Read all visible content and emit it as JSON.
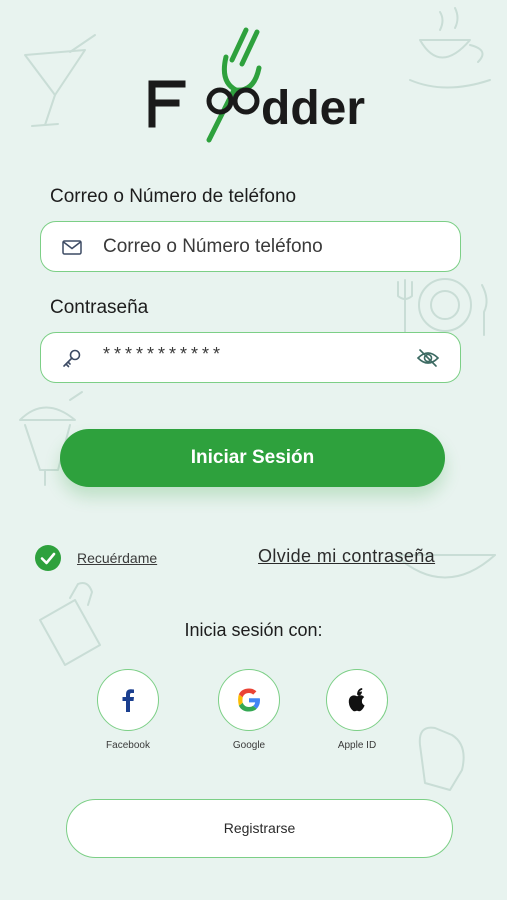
{
  "app": {
    "brand": "Foodder"
  },
  "form": {
    "email_label": "Correo o Número de teléfono",
    "email_placeholder": "Correo o Número teléfono",
    "password_label": "Contraseña",
    "password_value": "***********",
    "email_icon": "mail-icon",
    "password_icon": "key-icon",
    "toggle_icon": "eye-off-icon"
  },
  "actions": {
    "login_label": "Iniciar Sesión",
    "remember_label": "Recuérdame",
    "forgot_label": "Olvide mi contraseña",
    "register_label": "Registrarse"
  },
  "social": {
    "title": "Inicia sesión con:",
    "providers": [
      {
        "label": "Facebook",
        "icon": "facebook-icon"
      },
      {
        "label": "Google",
        "icon": "google-icon"
      },
      {
        "label": "Apple ID",
        "icon": "apple-icon"
      }
    ]
  },
  "colors": {
    "background": "#e8f3ef",
    "primary": "#2ea13d",
    "border": "#7ccf86",
    "brand_text": "#1a1a1a"
  }
}
